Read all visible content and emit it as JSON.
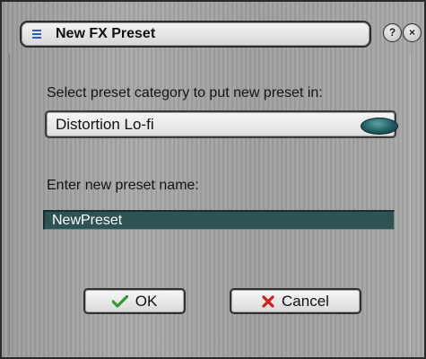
{
  "dialog": {
    "title": "New FX Preset",
    "help_glyph": "?",
    "close_glyph": "×"
  },
  "category": {
    "label": "Select preset category to put new preset in:",
    "selected": "Distortion Lo-fi"
  },
  "preset_name": {
    "label": "Enter new preset name:",
    "value": "NewPreset"
  },
  "buttons": {
    "ok_label": "OK",
    "cancel_label": "Cancel"
  },
  "icons": {
    "menu": "menu-icon",
    "help": "help-icon",
    "close": "close-icon",
    "ok": "checkmark-icon",
    "cancel": "x-mark-icon",
    "dropdown": "dropdown-knob-icon"
  },
  "colors": {
    "input_bg": "#2f5254",
    "knob": "#1f5d62",
    "check": "#2e9a2e",
    "cancel_x": "#d41c1c",
    "menu_icon": "#2e5bbd"
  }
}
